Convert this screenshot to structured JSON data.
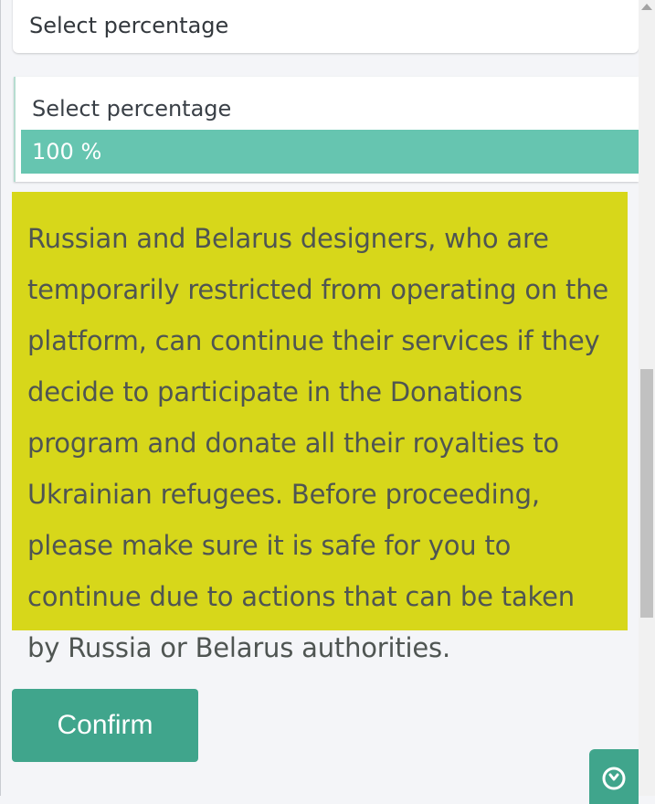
{
  "select_field": {
    "label": "Select percentage"
  },
  "dropdown": {
    "placeholder_option": "Select percentage",
    "selected_option": "100 %"
  },
  "notice": {
    "text": "Russian and Belarus designers, who are temporarily restricted from operating on the platform, can continue their services if they decide to participate in the Donations program and donate all their royalties to Ukrainian refugees. Before proceeding, please make sure it is safe for you to continue due to actions that can be taken by Russia or Belarus authorities."
  },
  "actions": {
    "confirm_label": "Confirm"
  },
  "floating_widget": {
    "icon": "chevron-circle-icon"
  },
  "colors": {
    "accent": "#40a58c",
    "selected_option": "#66c5b0",
    "notice_background": "#d7d71a"
  }
}
